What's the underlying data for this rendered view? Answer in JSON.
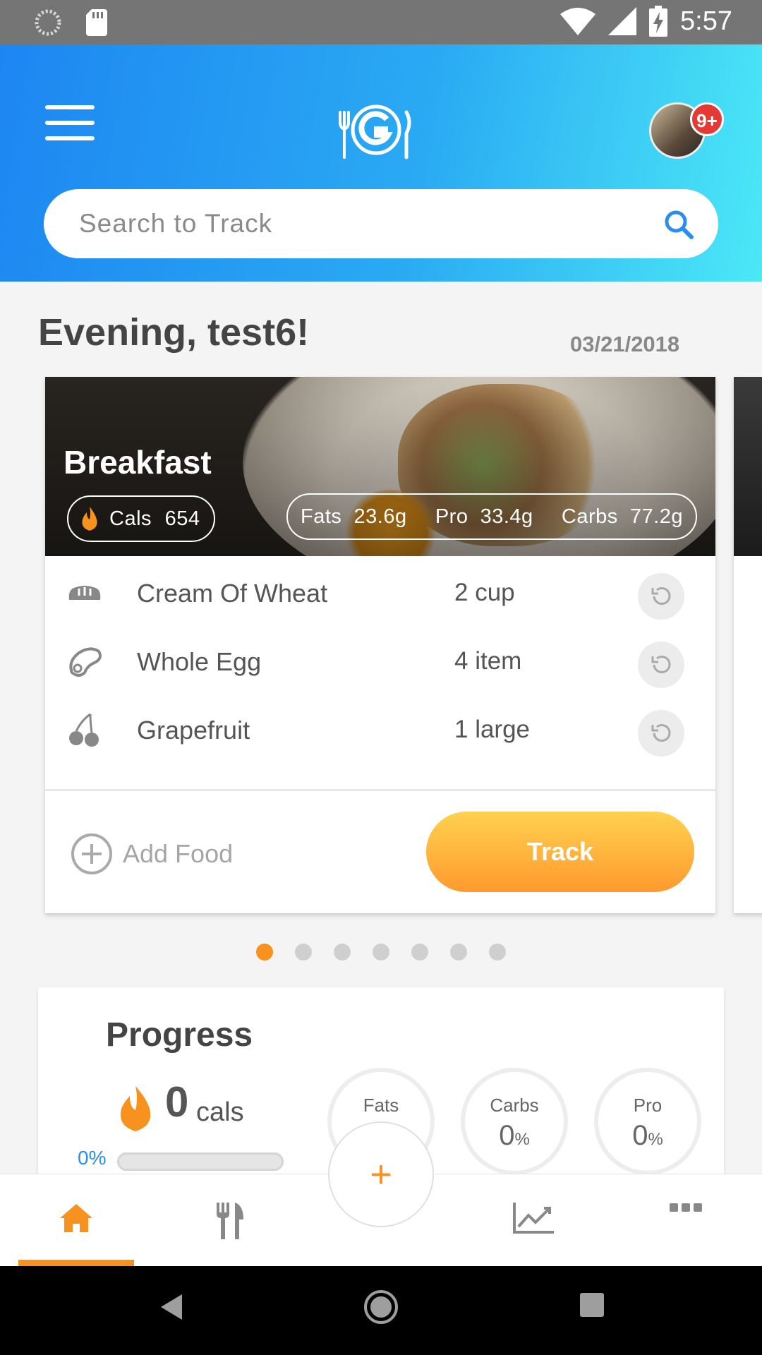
{
  "status_bar": {
    "time": "5:57",
    "icons": [
      "spinner-icon",
      "sd-card-icon",
      "wifi-icon",
      "cellular-icon",
      "battery-charging-icon"
    ]
  },
  "header": {
    "notification_count": "9+",
    "search_placeholder": "Search to Track",
    "brand_color": "#2a9df4"
  },
  "greeting": {
    "text": "Evening, test6!",
    "date": "03/21/2018"
  },
  "meal_card": {
    "title": "Breakfast",
    "cals_label": "Cals",
    "cals_value": "654",
    "fats_label": "Fats",
    "fats_value": "23.6g",
    "pro_label": "Pro",
    "pro_value": "33.4g",
    "carbs_label": "Carbs",
    "carbs_value": "77.2g",
    "items": [
      {
        "icon": "bread-icon",
        "name": "Cream Of Wheat",
        "qty": "2 cup"
      },
      {
        "icon": "steak-icon",
        "name": "Whole Egg",
        "qty": "4 item"
      },
      {
        "icon": "cherries-icon",
        "name": "Grapefruit",
        "qty": "1 large"
      }
    ],
    "add_food_label": "Add Food",
    "track_label": "Track",
    "accent_color": "#f7921e"
  },
  "pager": {
    "count": 7,
    "active_index": 0
  },
  "progress": {
    "title": "Progress",
    "cals_value": "0",
    "cals_unit": "cals",
    "cals_percent": "0%",
    "rings": [
      {
        "label": "Fats",
        "value": ""
      },
      {
        "label": "Carbs",
        "value": "0",
        "unit": "%"
      },
      {
        "label": "Pro",
        "value": "0",
        "unit": "%"
      }
    ]
  },
  "fab_label": "+",
  "bottom_nav": {
    "items": [
      "home-icon",
      "utensils-icon",
      "chart-line-icon",
      "more-icon"
    ],
    "active": "home-icon"
  }
}
